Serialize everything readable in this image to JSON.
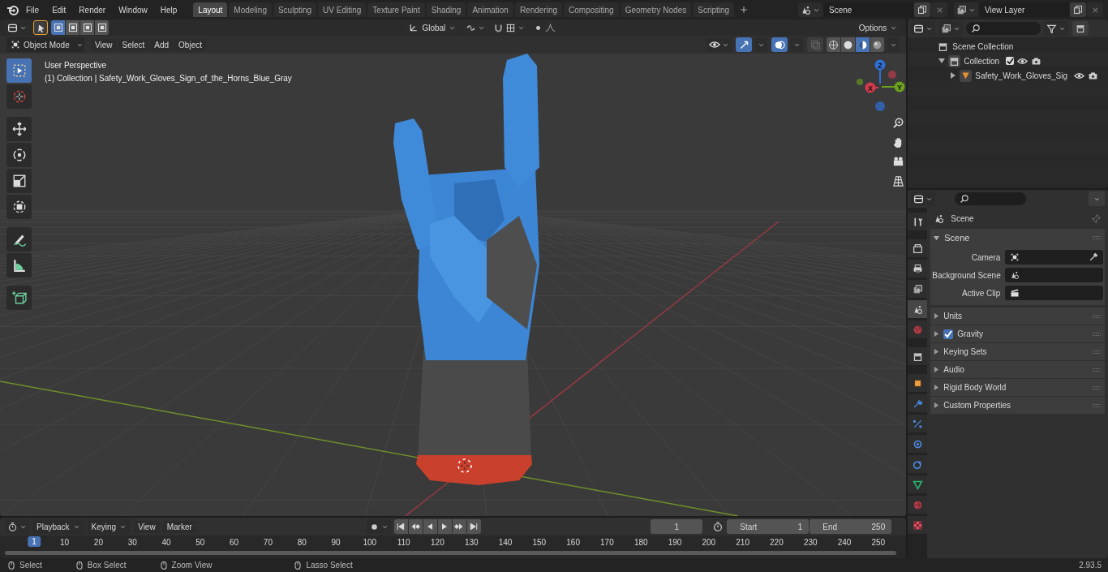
{
  "menu_bar": {
    "menus": [
      "File",
      "Edit",
      "Render",
      "Window",
      "Help"
    ]
  },
  "workspace_tabs": [
    {
      "label": "Layout",
      "selected": true
    },
    {
      "label": "Modeling",
      "selected": false
    },
    {
      "label": "Sculpting",
      "selected": false
    },
    {
      "label": "UV Editing",
      "selected": false
    },
    {
      "label": "Texture Paint",
      "selected": false
    },
    {
      "label": "Shading",
      "selected": false
    },
    {
      "label": "Animation",
      "selected": false
    },
    {
      "label": "Rendering",
      "selected": false
    },
    {
      "label": "Compositing",
      "selected": false
    },
    {
      "label": "Geometry Nodes",
      "selected": false
    },
    {
      "label": "Scripting",
      "selected": false
    }
  ],
  "scene_field": {
    "value": "Scene"
  },
  "view_layer_field": {
    "value": "View Layer"
  },
  "tool_settings": {
    "select_modes": [
      {
        "selected": true
      },
      {
        "selected": false
      },
      {
        "selected": false
      },
      {
        "selected": false
      }
    ],
    "orientation": "Global",
    "options": "Options"
  },
  "viewport_header": {
    "mode": "Object Mode",
    "menus": [
      "View",
      "Select",
      "Add",
      "Object"
    ],
    "shading_modes": [
      {
        "kind": "wire",
        "selected": false
      },
      {
        "kind": "solid",
        "selected": false
      },
      {
        "kind": "material",
        "selected": true
      },
      {
        "kind": "rendered",
        "selected": false
      }
    ]
  },
  "viewport": {
    "title": "User Perspective",
    "subtitle": "(1) Collection | Safety_Work_Gloves_Sign_of_the_Horns_Blue_Gray",
    "axes": [
      "Z",
      "X",
      "Y"
    ],
    "tools": [
      {
        "kind": "select",
        "selected": true
      },
      {
        "kind": "cursor",
        "selected": false
      },
      {
        "kind": "move",
        "selected": false
      },
      {
        "kind": "rotate",
        "selected": false
      },
      {
        "kind": "scale",
        "selected": false
      },
      {
        "kind": "transform",
        "selected": false
      },
      {
        "kind": "annotate",
        "selected": false
      },
      {
        "kind": "measure",
        "selected": false
      },
      {
        "kind": "addcube",
        "selected": false
      }
    ]
  },
  "outliner": {
    "items": [
      {
        "label": "Scene Collection",
        "kind": "scene",
        "children": [
          {
            "label": "Collection",
            "kind": "collection",
            "expanded": true,
            "checked": true,
            "children": [
              {
                "label": "Safety_Work_Gloves_Sig",
                "kind": "mesh",
                "expanded": false
              }
            ]
          }
        ]
      }
    ]
  },
  "properties": {
    "tabs": [
      {
        "kind": "tool",
        "selected": false
      },
      {
        "kind": "render",
        "selected": false
      },
      {
        "kind": "output",
        "selected": false
      },
      {
        "kind": "viewlayer",
        "selected": false
      },
      {
        "kind": "scene",
        "selected": true
      },
      {
        "kind": "world",
        "selected": false
      },
      {
        "kind": "collection",
        "selected": false
      },
      {
        "kind": "object",
        "selected": false
      },
      {
        "kind": "modifier",
        "selected": false
      },
      {
        "kind": "particles",
        "selected": false
      },
      {
        "kind": "physics",
        "selected": false
      },
      {
        "kind": "constraint",
        "selected": false
      },
      {
        "kind": "data",
        "selected": false
      },
      {
        "kind": "material",
        "selected": false
      },
      {
        "kind": "texture",
        "selected": false
      }
    ],
    "header": "Scene",
    "panel": {
      "title": "Scene",
      "expanded": true,
      "fields": [
        {
          "label": "Camera",
          "kind": "camera"
        },
        {
          "label": "Background Scene",
          "kind": "scene"
        },
        {
          "label": "Active Clip",
          "kind": "clip"
        }
      ]
    },
    "subpanels": [
      {
        "title": "Units",
        "kind": "plain"
      },
      {
        "title": "Gravity",
        "kind": "checkbox",
        "checked": true
      },
      {
        "title": "Keying Sets",
        "kind": "plain"
      },
      {
        "title": "Audio",
        "kind": "plain"
      },
      {
        "title": "Rigid Body World",
        "kind": "plain"
      },
      {
        "title": "Custom Properties",
        "kind": "plain"
      }
    ]
  },
  "timeline": {
    "menus": [
      "Playback",
      "Keying",
      "View",
      "Marker"
    ],
    "current_frame": "1",
    "start_label": "Start",
    "start": "1",
    "end_label": "End",
    "end": "250",
    "playhead": "1",
    "ticks": [
      "10",
      "20",
      "30",
      "40",
      "50",
      "60",
      "70",
      "80",
      "90",
      "100",
      "110",
      "120",
      "130",
      "140",
      "150",
      "160",
      "170",
      "180",
      "190",
      "200",
      "210",
      "220",
      "230",
      "240",
      "250"
    ]
  },
  "status_bar": {
    "items": [
      {
        "label": "Select"
      },
      {
        "label": "Box Select"
      },
      {
        "label": "Zoom View"
      },
      {
        "label": "Lasso Select"
      }
    ],
    "version": "2.93.5"
  }
}
